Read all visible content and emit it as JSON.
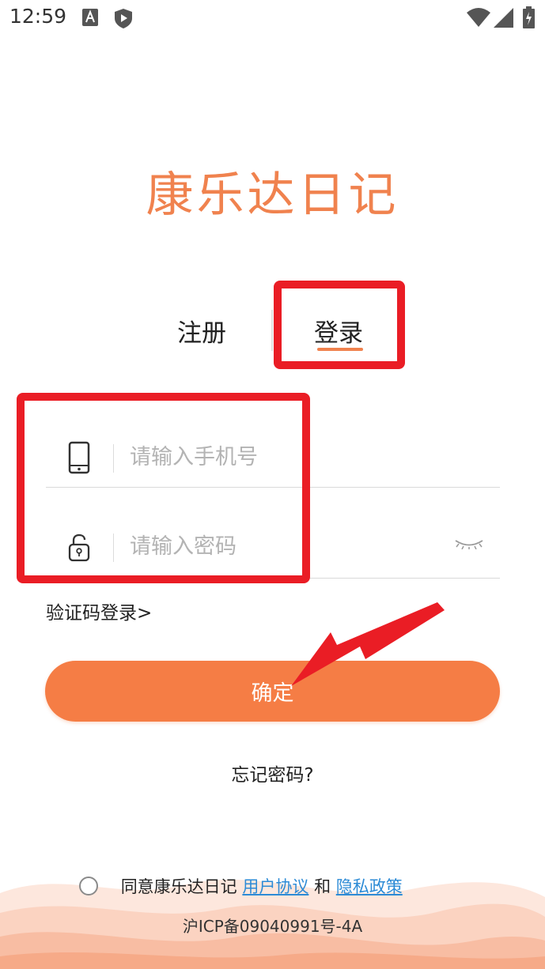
{
  "status_bar": {
    "time": "12:59",
    "left_icons": [
      "a-notification-icon",
      "shield-play-icon"
    ],
    "right_icons": [
      "wifi-icon",
      "cell-signal-icon",
      "battery-icon"
    ]
  },
  "app": {
    "logo_text": "康乐达日记",
    "brand_color": "#f0824e"
  },
  "tabs": {
    "register": "注册",
    "login": "登录",
    "active": "login"
  },
  "form": {
    "phone_placeholder": "请输入手机号",
    "phone_value": "",
    "password_placeholder": "请输入密码",
    "password_value": ""
  },
  "links": {
    "sms_login": "验证码登录>",
    "forgot_password": "忘记密码?"
  },
  "buttons": {
    "confirm": "确定",
    "confirm_color": "#f57d45"
  },
  "agreement": {
    "prefix": "同意康乐达日记",
    "user_agreement": "用户协议",
    "and": "和",
    "privacy_policy": "隐私政策",
    "checked": false
  },
  "footer": {
    "icp": "沪ICP备09040991号-4A"
  },
  "annotation": {
    "color": "#ea1d25"
  }
}
